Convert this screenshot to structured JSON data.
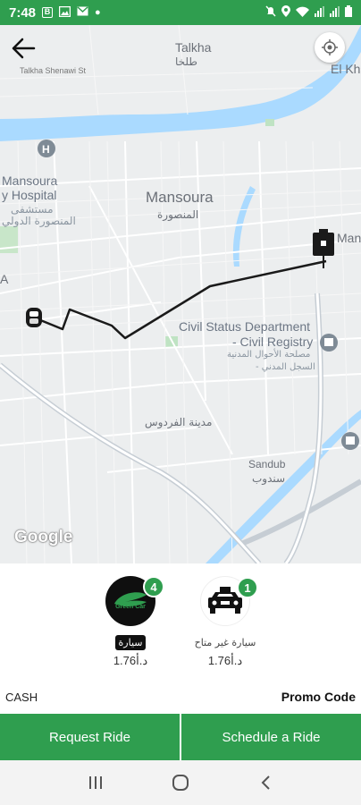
{
  "status_bar": {
    "time": "7:48",
    "icons_left": [
      "b-icon",
      "image-icon",
      "mail-icon",
      "dot-icon"
    ],
    "icons_right": [
      "mute-icon",
      "location-icon",
      "wifi-icon",
      "signal-icon",
      "signal-icon",
      "battery-icon"
    ]
  },
  "map": {
    "labels": {
      "talkha_en": "Talkha",
      "talkha_ar": "طلخا",
      "el_kh": "El Kh",
      "man": "Man",
      "mansoura_en": "Mansoura",
      "mansoura_ar": "المنصورة",
      "hospital_1": "Mansoura",
      "hospital_2": "y Hospital",
      "hospital_ar1": "مستشفى",
      "hospital_ar2": "المنصورة الدولي",
      "civil_1": "Civil Status Department",
      "civil_2": "- Civil Registry",
      "civil_ar1": "مصلحة الأحوال المدنية",
      "civil_ar2": "- السجل المدني",
      "ferdous": "مدينة الفردوس",
      "sandub_en": "Sandub",
      "sandub_ar": "سندوب",
      "road": "Talkha Shenawi St",
      "a": "A"
    },
    "google": "Google"
  },
  "vehicles": [
    {
      "name": "سيارة",
      "price": "1.76د.أ",
      "count": "4",
      "logo_text": "Green Car"
    },
    {
      "name": "سيارة غير متاح",
      "price": "1.76د.أ",
      "count": "1"
    }
  ],
  "payment_method": "CASH",
  "promo_label": "Promo Code",
  "buttons": {
    "request": "Request Ride",
    "schedule": "Schedule a Ride"
  },
  "colors": {
    "brand_green": "#2f9e4f",
    "river": "#aadaff",
    "route": "#1a1a1a"
  }
}
